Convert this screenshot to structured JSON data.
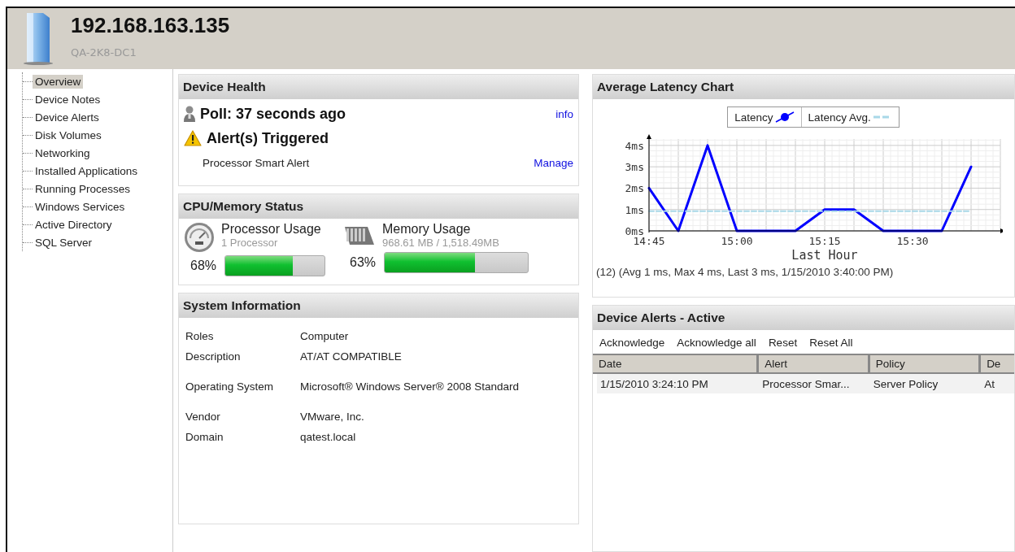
{
  "header": {
    "title": "192.168.163.135",
    "subtitle": "QA-2K8-DC1"
  },
  "sidebar": {
    "items": [
      {
        "label": "Overview",
        "selected": true
      },
      {
        "label": "Device Notes",
        "selected": false
      },
      {
        "label": "Device Alerts",
        "selected": false
      },
      {
        "label": "Disk Volumes",
        "selected": false
      },
      {
        "label": "Networking",
        "selected": false
      },
      {
        "label": "Installed Applications",
        "selected": false
      },
      {
        "label": "Running Processes",
        "selected": false
      },
      {
        "label": "Windows Services",
        "selected": false
      },
      {
        "label": "Active Directory",
        "selected": false
      },
      {
        "label": "SQL Server",
        "selected": false
      }
    ]
  },
  "device_health": {
    "title": "Device Health",
    "poll": "Poll: 37 seconds ago",
    "info_link": "info",
    "alert_heading": "Alert(s) Triggered",
    "alerts": [
      {
        "name": "Processor Smart Alert",
        "link": "Manage"
      }
    ]
  },
  "cpu_memory": {
    "title": "CPU/Memory Status",
    "meters": [
      {
        "kind": "processor",
        "name": "Processor Usage",
        "detail": "1 Processor",
        "reading": "68%",
        "level": 0.68
      },
      {
        "kind": "memory",
        "name": "Memory Usage",
        "detail": "968.61 MB / 1,518.49MB",
        "reading": "63%",
        "level": 0.63
      }
    ]
  },
  "system_information": {
    "title": "System Information",
    "rows": [
      {
        "label": "Roles",
        "value": "Computer"
      },
      {
        "label": "Description",
        "value": "AT/AT COMPATIBLE"
      },
      {
        "label": "Operating System",
        "value": "Microsoft® Windows Server® 2008 Standard"
      },
      {
        "label": "Vendor",
        "value": "VMware, Inc."
      },
      {
        "label": "Domain",
        "value": "qatest.local"
      }
    ]
  },
  "latency_chart": {
    "title": "Average Latency Chart",
    "summary": "(12) (Avg 1 ms, Max 4 ms, Last 3 ms, 1/15/2010 3:40:00 PM)",
    "chart_data": {
      "type": "line",
      "xlabel": "Last Hour",
      "x": [
        885,
        890,
        895,
        900,
        905,
        910,
        915,
        920,
        925,
        930,
        935,
        940
      ],
      "series": [
        {
          "name": "Latency",
          "color": "#0000ff",
          "line_style": "solid",
          "values": [
            2,
            0,
            4,
            0,
            0,
            0,
            1,
            1,
            0,
            0,
            0,
            3
          ]
        },
        {
          "name": "Latency Avg.",
          "color": "#a8d8e8",
          "line_style": "dashed",
          "values": [
            0.92,
            0.92,
            0.92,
            0.92,
            0.92,
            0.92,
            0.92,
            0.92,
            0.92,
            0.92,
            0.92,
            0.92
          ]
        }
      ],
      "grid": true,
      "xlim": [
        885,
        945
      ],
      "ylim": [
        0,
        4.3
      ],
      "xticks": [
        {
          "value": 885,
          "label": "14:45"
        },
        {
          "value": 900,
          "label": "15:00"
        },
        {
          "value": 915,
          "label": "15:15"
        },
        {
          "value": 930,
          "label": "15:30"
        }
      ],
      "yticks": [
        {
          "value": 0,
          "label": "0ms"
        },
        {
          "value": 1,
          "label": "1ms"
        },
        {
          "value": 2,
          "label": "2ms"
        },
        {
          "value": 3,
          "label": "3ms"
        },
        {
          "value": 4,
          "label": "4ms"
        }
      ]
    }
  },
  "device_alerts": {
    "title": "Device Alerts - Active",
    "actions": [
      "Acknowledge",
      "Acknowledge all",
      "Reset",
      "Reset All"
    ],
    "table": {
      "columns": [
        "Date",
        "Alert",
        "Policy",
        "De"
      ],
      "rows": [
        [
          "1/15/2010 3:24:10 PM",
          "Processor Smar...",
          "Server Policy",
          "At"
        ]
      ]
    }
  }
}
